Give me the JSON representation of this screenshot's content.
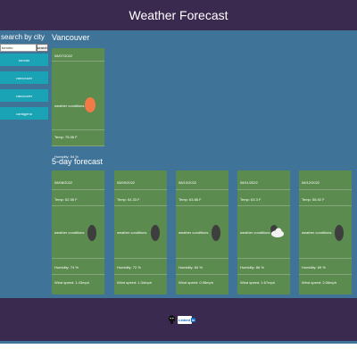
{
  "header": {
    "title": "Weather Forecast"
  },
  "sidebar": {
    "title": "search by city",
    "search_value": "toronto",
    "search_button": "search",
    "history": [
      "toronto",
      "vancouver",
      "vancouver",
      "cartagena"
    ]
  },
  "current": {
    "city": "Vancouver",
    "date": "08/07/2022",
    "conditions_label": "weather conditions",
    "temp": "Temp: 75.06 F",
    "humidity": "Humidity: 54 %",
    "icon": "sun-icon"
  },
  "forecast": {
    "title": "5-day forecast",
    "days": [
      {
        "date": "08/08/2022",
        "temp": "Temp: 62.55 F",
        "conditions": "weather conditions",
        "humidity": "Humidity: 74 %",
        "wind": "Wind speed: 1.43mph",
        "icon": "dark-cloud-icon"
      },
      {
        "date": "08/09/2022",
        "temp": "Temp: 64.33 F",
        "conditions": "weather conditions",
        "humidity": "Humidity: 72 %",
        "wind": "Wind speed: 1.34mph",
        "icon": "dark-cloud-icon"
      },
      {
        "date": "08/10/2022",
        "temp": "Temp: 63.86 F",
        "conditions": "weather conditions",
        "humidity": "Humidity: 84 %",
        "wind": "Wind speed: 0.98mph",
        "icon": "dark-cloud-icon"
      },
      {
        "date": "08/11/2022",
        "temp": "Temp: 63.3 F",
        "conditions": "weather conditions",
        "humidity": "Humidity: 86 %",
        "wind": "Wind speed: 1.67mph",
        "icon": "cloud-icon"
      },
      {
        "date": "08/12/2022",
        "temp": "Temp: 58.92 F",
        "conditions": "weather conditions",
        "humidity": "Humidity: 69 %",
        "wind": "Wind speed: 2.06mph",
        "icon": "dark-cloud-icon"
      }
    ]
  },
  "footer": {
    "linkedin_label": "Linked",
    "linkedin_in": "in"
  },
  "colors": {
    "header": "#3b2a4f",
    "main": "#3f7397",
    "card": "#5b8b4e",
    "history_button": "#1aa3b5",
    "sun": "#f27a47"
  }
}
